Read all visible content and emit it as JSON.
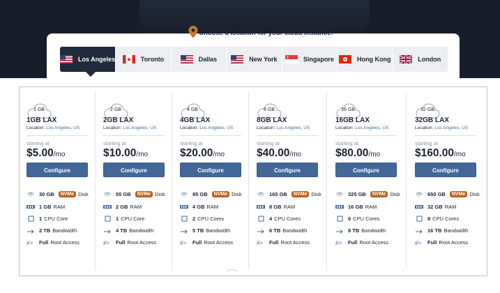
{
  "location": {
    "title": "Choose a location for your cloud instance:",
    "tabs": [
      {
        "label": "Los Angeles",
        "flag": "us-flag",
        "active": true
      },
      {
        "label": "Toronto",
        "flag": "ca-flag",
        "active": false
      },
      {
        "label": "Dallas",
        "flag": "us-flag",
        "active": false
      },
      {
        "label": "New York",
        "flag": "us-flag",
        "active": false
      },
      {
        "label": "Singapore",
        "flag": "sg-flag",
        "active": false
      },
      {
        "label": "Hong Kong",
        "flag": "hk-flag",
        "active": false
      },
      {
        "label": "London",
        "flag": "uk-flag",
        "active": false
      }
    ]
  },
  "plans": [
    {
      "ram_badge": "1 GB",
      "name": "1GB LAX",
      "location_label": "Location:",
      "location_city": "Los Angeles, US",
      "starting_label": "starting at",
      "price": "$5.00",
      "per": "/mo",
      "cta": "Configure",
      "disk": "30 GB",
      "disk_type": "NVMe",
      "disk_suffix": "Disk",
      "ram": "1 GB",
      "ram_suffix": "RAM",
      "cpu": "1",
      "cpu_suffix": "CPU Core",
      "bw": "2 TB",
      "bw_suffix": "Bandwidth",
      "root": "Full",
      "root_suffix": "Root Access"
    },
    {
      "ram_badge": "2 GB",
      "name": "2GB LAX",
      "location_label": "Location:",
      "location_city": "Los Angeles, US",
      "starting_label": "starting at",
      "price": "$10.00",
      "per": "/mo",
      "cta": "Configure",
      "disk": "55 GB",
      "disk_type": "NVMe",
      "disk_suffix": "Disk",
      "ram": "2 GB",
      "ram_suffix": "RAM",
      "cpu": "1",
      "cpu_suffix": "CPU Core",
      "bw": "4 TB",
      "bw_suffix": "Bandwidth",
      "root": "Full",
      "root_suffix": "Root Access"
    },
    {
      "ram_badge": "4 GB",
      "name": "4GB LAX",
      "location_label": "Location:",
      "location_city": "Los Angeles, US",
      "starting_label": "starting at",
      "price": "$20.00",
      "per": "/mo",
      "cta": "Configure",
      "disk": "85 GB",
      "disk_type": "NVMe",
      "disk_suffix": "Disk",
      "ram": "4 GB",
      "ram_suffix": "RAM",
      "cpu": "2",
      "cpu_suffix": "CPU Cores",
      "bw": "5 TB",
      "bw_suffix": "Bandwidth",
      "root": "Full",
      "root_suffix": "Root Access"
    },
    {
      "ram_badge": "8 GB",
      "name": "8GB LAX",
      "location_label": "Location:",
      "location_city": "Los Angeles, US",
      "starting_label": "starting at",
      "price": "$40.00",
      "per": "/mo",
      "cta": "Configure",
      "disk": "165 GB",
      "disk_type": "NVMe",
      "disk_suffix": "Disk",
      "ram": "8 GB",
      "ram_suffix": "RAM",
      "cpu": "4",
      "cpu_suffix": "CPU Cores",
      "bw": "6 TB",
      "bw_suffix": "Bandwidth",
      "root": "Full",
      "root_suffix": "Root Access"
    },
    {
      "ram_badge": "16 GB",
      "name": "16GB LAX",
      "location_label": "Location:",
      "location_city": "Los Angeles, US",
      "starting_label": "starting at",
      "price": "$80.00",
      "per": "/mo",
      "cta": "Configure",
      "disk": "325 GB",
      "disk_type": "NVMe",
      "disk_suffix": "Disk",
      "ram": "16 GB",
      "ram_suffix": "RAM",
      "cpu": "6",
      "cpu_suffix": "CPU Cores",
      "bw": "8 TB",
      "bw_suffix": "Bandwidth",
      "root": "Full",
      "root_suffix": "Root Access"
    },
    {
      "ram_badge": "32 GB",
      "name": "32GB LAX",
      "location_label": "Location:",
      "location_city": "Los Angeles, US",
      "starting_label": "starting at",
      "price": "$160.00",
      "per": "/mo",
      "cta": "Configure",
      "disk": "650 GB",
      "disk_type": "NVMe",
      "disk_suffix": "Disk",
      "ram": "32 GB",
      "ram_suffix": "RAM",
      "cpu": "8",
      "cpu_suffix": "CPU Cores",
      "bw": "16 TB",
      "bw_suffix": "Bandwidth",
      "root": "Full",
      "root_suffix": "Root Access"
    }
  ],
  "colors": {
    "hero_bg": "#171d2a",
    "active_tab": "#1f2a3c",
    "cta": "#44679a",
    "nvme_badge": "#b8621e",
    "city_link": "#3e6da6"
  }
}
